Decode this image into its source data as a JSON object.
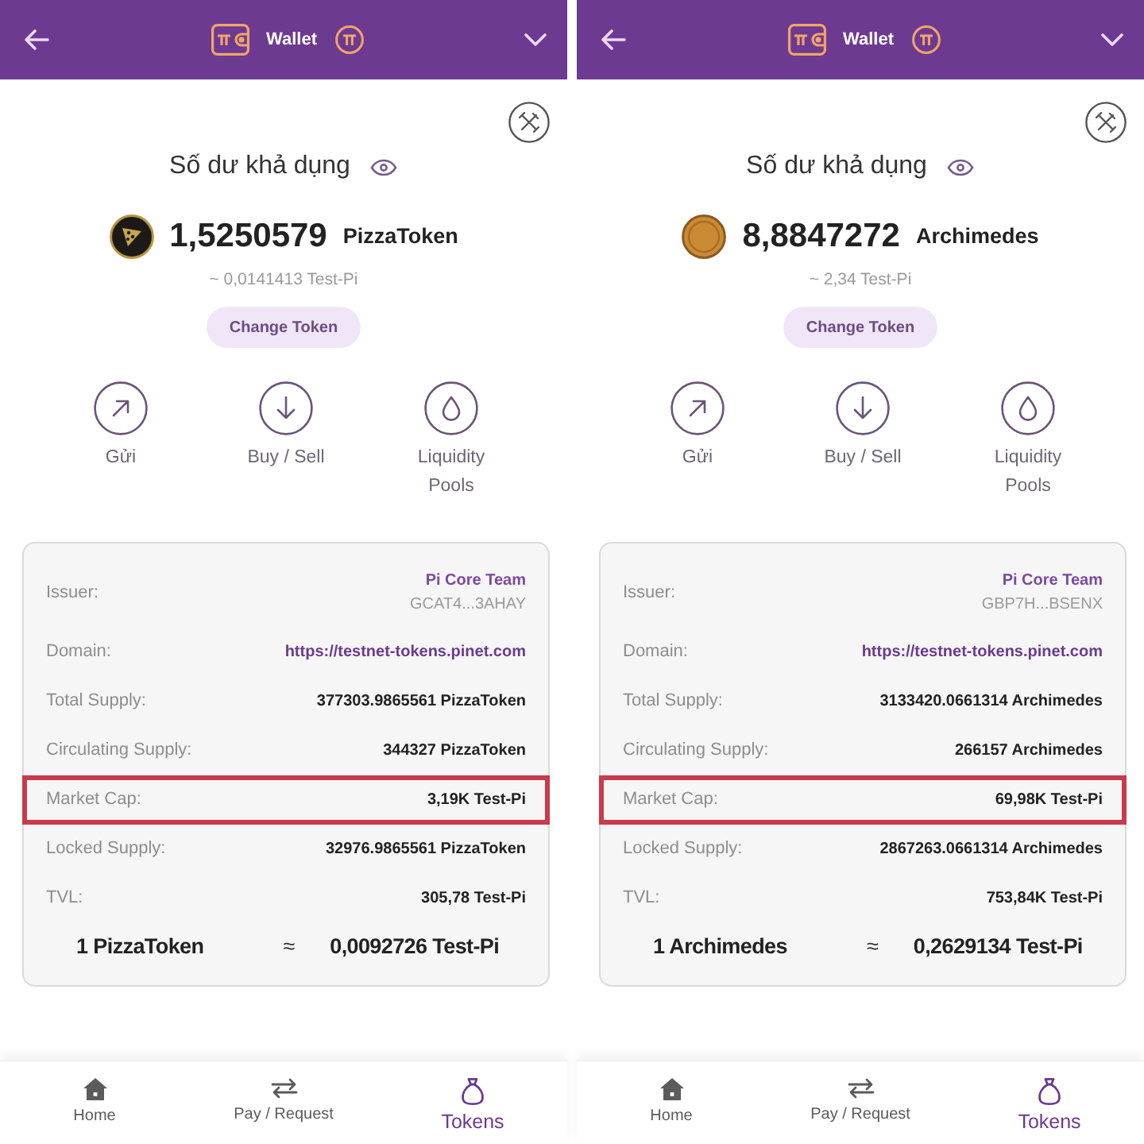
{
  "panels": [
    {
      "header": {
        "title": "Wallet"
      },
      "balance_label": "Số dư khả dụng",
      "balance": {
        "kind": "pizza",
        "amount": "1,5250579",
        "token": "PizzaToken",
        "approx": "~ 0,0141413 Test-Pi"
      },
      "change_button": "Change Token",
      "actions": [
        {
          "kind": "send",
          "label": "Gửi"
        },
        {
          "kind": "buy_sell",
          "label": "Buy / Sell"
        },
        {
          "kind": "liquidity",
          "label": "Liquidity Pools"
        }
      ],
      "details": [
        {
          "kind": "issuer",
          "label": "Issuer:",
          "value": "Pi Core Team",
          "address": "GCAT4...3AHAY",
          "highlighted": false
        },
        {
          "kind": "link",
          "label": "Domain:",
          "value": "https://testnet-tokens.pinet.com",
          "highlighted": false
        },
        {
          "kind": "plain",
          "label": "Total Supply:",
          "value": "377303.9865561 PizzaToken",
          "highlighted": false
        },
        {
          "kind": "plain",
          "label": "Circulating Supply:",
          "value": "344327 PizzaToken",
          "highlighted": false
        },
        {
          "kind": "plain",
          "label": "Market Cap:",
          "value": "3,19K Test-Pi",
          "highlighted": true
        },
        {
          "kind": "plain",
          "label": "Locked Supply:",
          "value": "32976.9865561 PizzaToken",
          "highlighted": false
        },
        {
          "kind": "plain",
          "label": "TVL:",
          "value": "305,78 Test-Pi",
          "highlighted": false
        }
      ],
      "conversion": {
        "from": "1 PizzaToken",
        "sign": "≈",
        "to": "0,0092726 Test-Pi"
      },
      "nav": [
        {
          "kind": "home",
          "label": "Home",
          "selected": false
        },
        {
          "kind": "swap",
          "label": "Pay / Request",
          "selected": false
        },
        {
          "kind": "tokens",
          "label": "Tokens",
          "selected": true
        }
      ]
    },
    {
      "header": {
        "title": "Wallet"
      },
      "balance_label": "Số dư khả dụng",
      "balance": {
        "kind": "portrait",
        "amount": "8,8847272",
        "token": "Archimedes",
        "approx": "~ 2,34 Test-Pi"
      },
      "change_button": "Change Token",
      "actions": [
        {
          "kind": "send",
          "label": "Gửi"
        },
        {
          "kind": "buy_sell",
          "label": "Buy / Sell"
        },
        {
          "kind": "liquidity",
          "label": "Liquidity Pools"
        }
      ],
      "details": [
        {
          "kind": "issuer",
          "label": "Issuer:",
          "value": "Pi Core Team",
          "address": "GBP7H...BSENX",
          "highlighted": false
        },
        {
          "kind": "link",
          "label": "Domain:",
          "value": "https://testnet-tokens.pinet.com",
          "highlighted": false
        },
        {
          "kind": "plain",
          "label": "Total Supply:",
          "value": "3133420.0661314 Archimedes",
          "highlighted": false
        },
        {
          "kind": "plain",
          "label": "Circulating Supply:",
          "value": "266157 Archimedes",
          "highlighted": false
        },
        {
          "kind": "plain",
          "label": "Market Cap:",
          "value": "69,98K Test-Pi",
          "highlighted": true
        },
        {
          "kind": "plain",
          "label": "Locked Supply:",
          "value": "2867263.0661314 Archimedes",
          "highlighted": false
        },
        {
          "kind": "plain",
          "label": "TVL:",
          "value": "753,84K Test-Pi",
          "highlighted": false
        }
      ],
      "conversion": {
        "from": "1 Archimedes",
        "sign": "≈",
        "to": "0,2629134 Test-Pi"
      },
      "nav": [
        {
          "kind": "home",
          "label": "Home",
          "selected": false
        },
        {
          "kind": "swap",
          "label": "Pay / Request",
          "selected": false
        },
        {
          "kind": "tokens",
          "label": "Tokens",
          "selected": true
        }
      ]
    }
  ]
}
